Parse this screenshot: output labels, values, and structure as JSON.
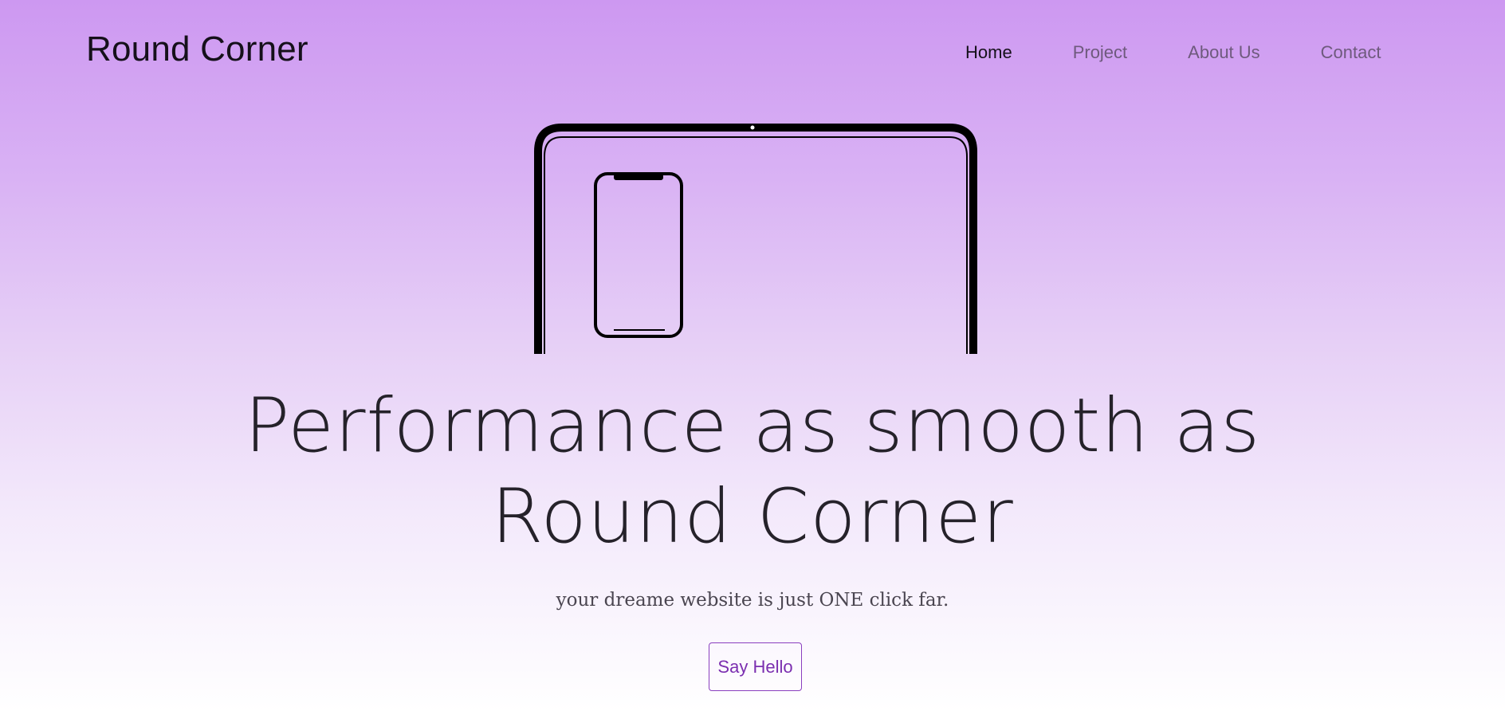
{
  "header": {
    "brand": "Round Corner",
    "nav": [
      {
        "label": "Home",
        "active": true
      },
      {
        "label": "Project",
        "active": false
      },
      {
        "label": "About Us",
        "active": false
      },
      {
        "label": "Contact",
        "active": false
      }
    ]
  },
  "hero": {
    "illustration": {
      "icons": [
        "laptop-outline-icon",
        "phone-outline-icon"
      ],
      "stroke_color": "#000000"
    },
    "headline_line1": "Performance as smooth as",
    "headline_line2": "Round Corner",
    "subtext": "your dreame website is just ONE click far.",
    "cta_label": "Say Hello"
  },
  "colors": {
    "gradient_top": "#cd98f1",
    "gradient_bottom": "#ffffff",
    "accent": "#7b2fb0",
    "nav_inactive": "#6e5a7d",
    "text_dark": "#15101a"
  }
}
